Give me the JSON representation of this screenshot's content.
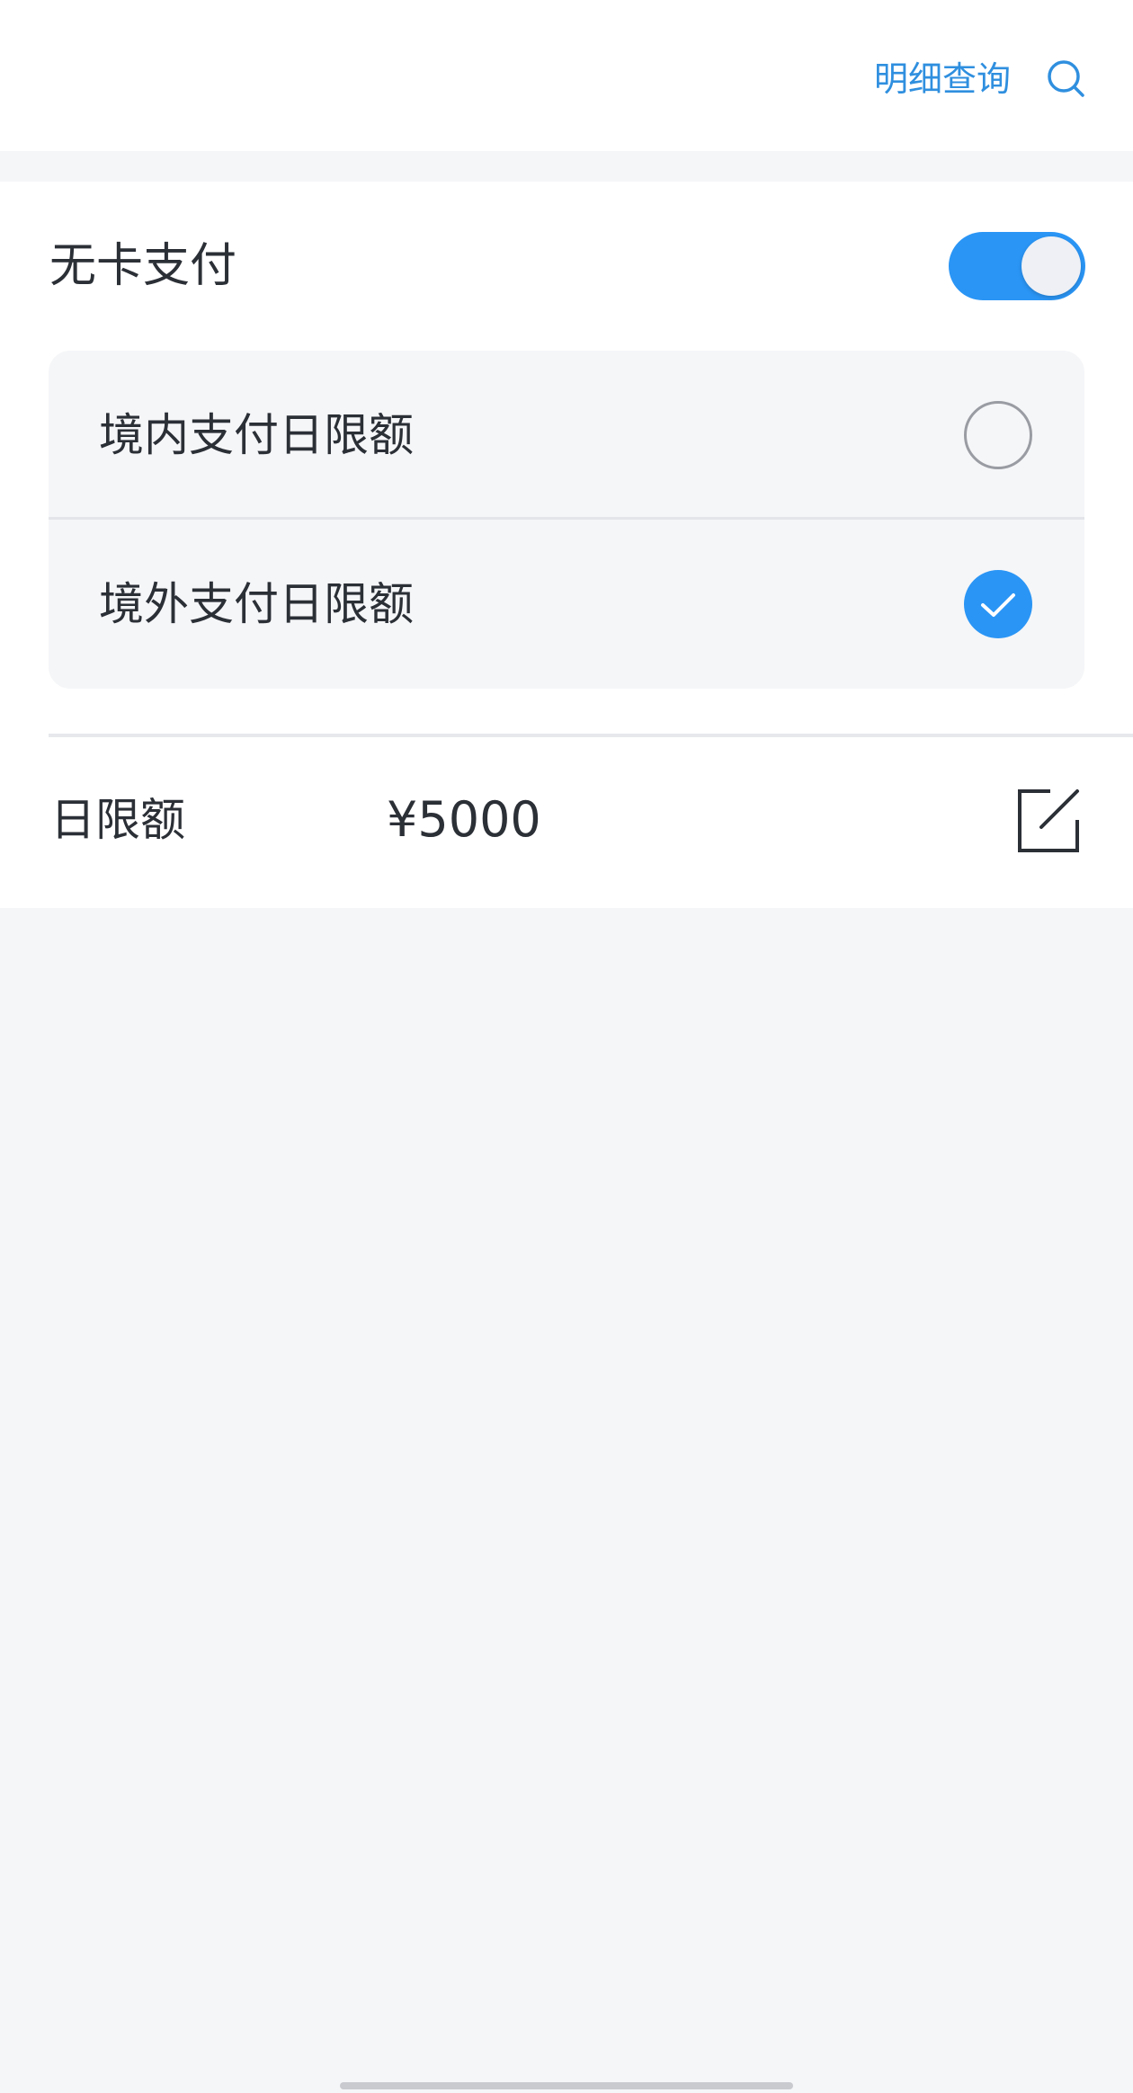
{
  "header": {
    "detail_query_label": "明细查询",
    "search_icon": "search-icon",
    "accent_color": "#2f8fdf"
  },
  "cardless_payment": {
    "label": "无卡支付",
    "enabled": true,
    "toggle_color": "#2a95f5"
  },
  "limit_options": [
    {
      "label": "境内支付日限额",
      "selected": false
    },
    {
      "label": "境外支付日限额",
      "selected": true
    }
  ],
  "daily_limit": {
    "label": "日限额",
    "value": "¥5000",
    "edit_icon": "edit-icon"
  }
}
